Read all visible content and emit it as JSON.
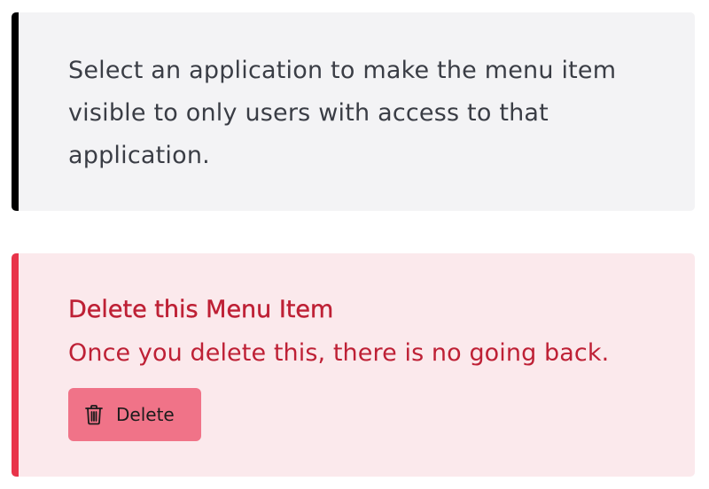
{
  "info": {
    "text": "Select an application to make the menu item visible to only users with access to that application."
  },
  "danger_zone": {
    "title": "Delete this Menu Item",
    "description": "Once you delete this, there is no going back.",
    "delete_button": {
      "label": "Delete",
      "icon": "trash-icon"
    }
  },
  "colors": {
    "info_background": "#f3f3f5",
    "info_accent": "#000000",
    "danger_background": "#fbe9ec",
    "danger_accent": "#e8344a",
    "danger_text": "#be2035",
    "delete_button_background": "#f07388"
  }
}
